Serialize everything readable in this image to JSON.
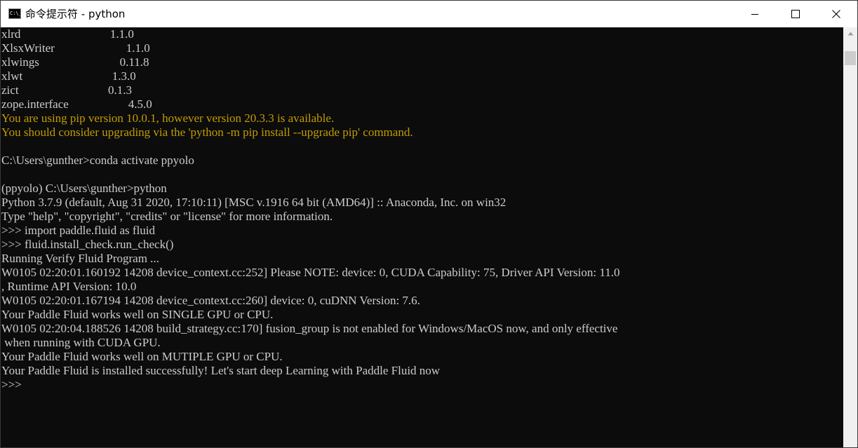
{
  "window": {
    "title": "命令提示符 - python",
    "icon_text": "C:\\_"
  },
  "controls": {
    "minimize_icon": "minimize-icon",
    "maximize_icon": "maximize-icon",
    "close_icon": "close-icon"
  },
  "console": {
    "text_color": "#cccccc",
    "warning_color": "#c19c00",
    "background": "#0c0c0c",
    "lines": [
      {
        "text": "xlrd                              1.1.0",
        "kind": "normal"
      },
      {
        "text": "XlsxWriter                        1.1.0",
        "kind": "normal"
      },
      {
        "text": "xlwings                           0.11.8",
        "kind": "normal"
      },
      {
        "text": "xlwt                              1.3.0",
        "kind": "normal"
      },
      {
        "text": "zict                              0.1.3",
        "kind": "normal"
      },
      {
        "text": "zope.interface                    4.5.0",
        "kind": "normal"
      },
      {
        "text": "You are using pip version 10.0.1, however version 20.3.3 is available.",
        "kind": "warning"
      },
      {
        "text": "You should consider upgrading via the 'python -m pip install --upgrade pip' command.",
        "kind": "warning"
      },
      {
        "text": "",
        "kind": "normal"
      },
      {
        "text": "C:\\Users\\gunther>conda activate ppyolo",
        "kind": "normal"
      },
      {
        "text": "",
        "kind": "normal"
      },
      {
        "text": "(ppyolo) C:\\Users\\gunther>python",
        "kind": "normal"
      },
      {
        "text": "Python 3.7.9 (default, Aug 31 2020, 17:10:11) [MSC v.1916 64 bit (AMD64)] :: Anaconda, Inc. on win32",
        "kind": "normal"
      },
      {
        "text": "Type \"help\", \"copyright\", \"credits\" or \"license\" for more information.",
        "kind": "normal"
      },
      {
        "text": ">>> import paddle.fluid as fluid",
        "kind": "normal"
      },
      {
        "text": ">>> fluid.install_check.run_check()",
        "kind": "normal"
      },
      {
        "text": "Running Verify Fluid Program ...",
        "kind": "normal"
      },
      {
        "text": "W0105 02:20:01.160192 14208 device_context.cc:252] Please NOTE: device: 0, CUDA Capability: 75, Driver API Version: 11.0",
        "kind": "normal"
      },
      {
        "text": ", Runtime API Version: 10.0",
        "kind": "normal"
      },
      {
        "text": "W0105 02:20:01.167194 14208 device_context.cc:260] device: 0, cuDNN Version: 7.6.",
        "kind": "normal"
      },
      {
        "text": "Your Paddle Fluid works well on SINGLE GPU or CPU.",
        "kind": "normal"
      },
      {
        "text": "W0105 02:20:04.188526 14208 build_strategy.cc:170] fusion_group is not enabled for Windows/MacOS now, and only effective",
        "kind": "normal"
      },
      {
        "text": " when running with CUDA GPU.",
        "kind": "normal"
      },
      {
        "text": "Your Paddle Fluid works well on MUTIPLE GPU or CPU.",
        "kind": "normal"
      },
      {
        "text": "Your Paddle Fluid is installed successfully! Let's start deep Learning with Paddle Fluid now",
        "kind": "normal"
      },
      {
        "text": ">>>",
        "kind": "normal"
      }
    ]
  },
  "scrollbar": {
    "up_icon": "scroll-up-arrow-icon"
  }
}
